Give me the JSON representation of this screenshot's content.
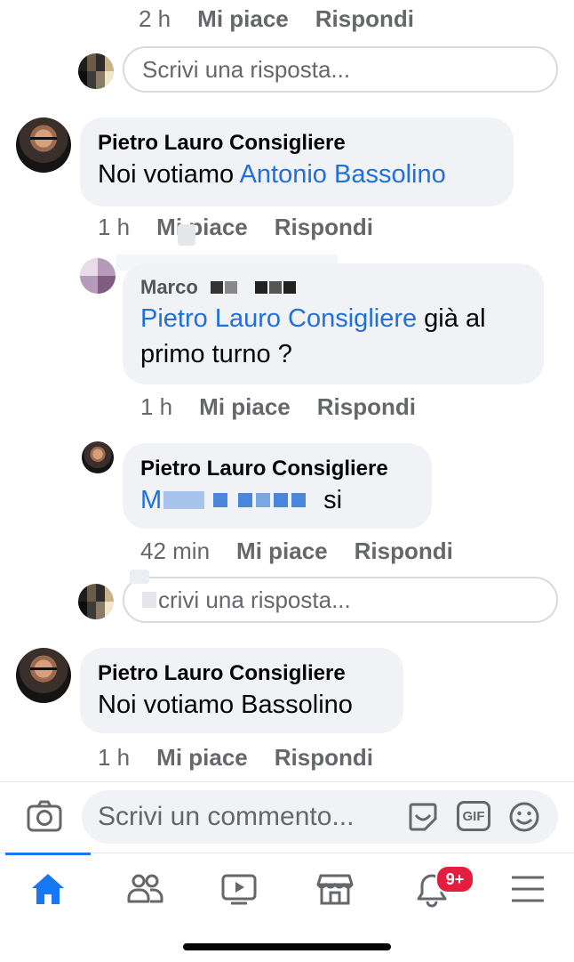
{
  "top_meta": {
    "time": "2 h",
    "like": "Mi piace",
    "reply": "Rispondi"
  },
  "reply_box_1": {
    "placeholder": "Scrivi una risposta..."
  },
  "comment1": {
    "author": "Pietro Lauro Consigliere",
    "text_prefix": "Noi votiamo ",
    "mention": "Antonio Bassolino",
    "meta": {
      "time": "1 h",
      "like": "Mi piace",
      "reply": "Rispondi"
    }
  },
  "reply1": {
    "author": "Marco",
    "mention": "Pietro Lauro Consigliere",
    "text_line1": " già al",
    "text_line2": "primo turno ?",
    "meta": {
      "time": "1 h",
      "like": "Mi piace",
      "reply": "Rispondi"
    }
  },
  "reply2": {
    "author": "Pietro Lauro Consigliere",
    "mention": "M",
    "text": "si",
    "meta": {
      "time": "42 min",
      "like": "Mi piace",
      "reply": "Rispondi"
    }
  },
  "reply_box_2": {
    "placeholder": "crivi una risposta..."
  },
  "comment2": {
    "author": "Pietro Lauro Consigliere",
    "text": "Noi votiamo Bassolino",
    "meta": {
      "time": "1 h",
      "like": "Mi piace",
      "reply": "Rispondi"
    }
  },
  "composer": {
    "placeholder": "Scrivi un commento...",
    "gif_label": "GIF"
  },
  "nav": {
    "notifications_badge": "9+"
  },
  "colors": {
    "accent": "#1877f2",
    "link": "#216fdb",
    "bubble": "#f0f2f5",
    "meta": "#65676b",
    "badge": "#e41e3f"
  }
}
